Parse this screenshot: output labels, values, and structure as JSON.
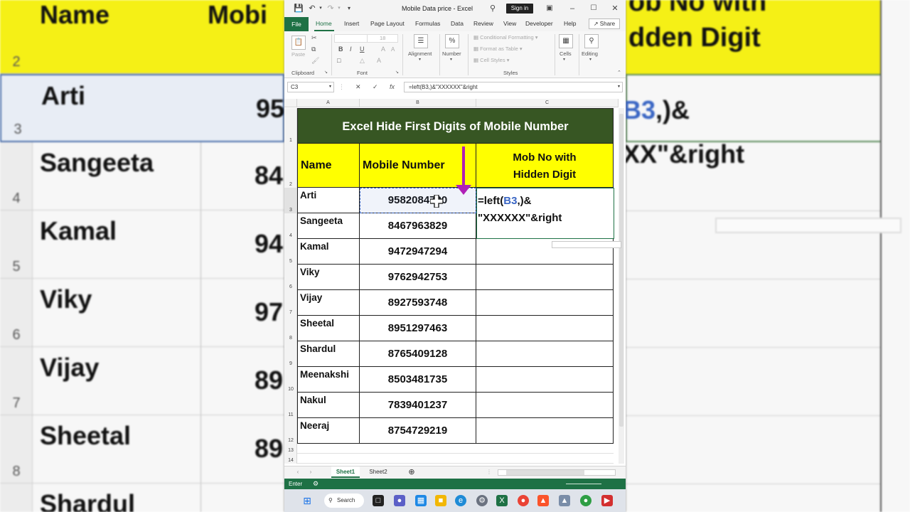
{
  "window": {
    "title": "Mobile Data price  -  Excel",
    "signin": "Sign in"
  },
  "tabs": {
    "file": "File",
    "items": [
      "Home",
      "Insert",
      "Page Layout",
      "Formulas",
      "Data",
      "Review",
      "View",
      "Developer",
      "Help"
    ],
    "share": "Share"
  },
  "ribbon": {
    "clipboard": "Clipboard",
    "paste": "Paste",
    "font": "Font",
    "alignment": "Alignment",
    "number": "Number",
    "conditional_formatting": "Conditional Formatting",
    "format_as_table": "Format as Table",
    "cell_styles": "Cell Styles",
    "styles": "Styles",
    "cells": "Cells",
    "editing": "Editing",
    "font_size": "18"
  },
  "formula_bar": {
    "name_box": "C3",
    "formula": "=left(B3,)&\"XXXXXX\"&right"
  },
  "columns": [
    "A",
    "B",
    "C"
  ],
  "sheet": {
    "title": "Excel Hide First Digits of Mobile Number",
    "header_name": "Name",
    "header_mobile": "Mobile Number",
    "header_hidden_line1": "Mob No with",
    "header_hidden_line2": "Hidden Digit",
    "formula_text_pre": "=left(",
    "formula_text_ref": "B3",
    "formula_text_mid": ",)&",
    "formula_text_line2": "\"XXXXXX\"&right",
    "rows": [
      {
        "row": "3",
        "name": "Arti",
        "mobile": "9582084720"
      },
      {
        "row": "4",
        "name": "Sangeeta",
        "mobile": "8467963829"
      },
      {
        "row": "5",
        "name": "Kamal",
        "mobile": "9472947294"
      },
      {
        "row": "6",
        "name": "Viky",
        "mobile": "9762942753"
      },
      {
        "row": "7",
        "name": "Vijay",
        "mobile": "8927593748"
      },
      {
        "row": "8",
        "name": "Sheetal",
        "mobile": "8951297463"
      },
      {
        "row": "9",
        "name": "Shardul",
        "mobile": "8765409128"
      },
      {
        "row": "10",
        "name": "Meenakshi",
        "mobile": "8503481735"
      },
      {
        "row": "11",
        "name": "Nakul",
        "mobile": "7839401237"
      },
      {
        "row": "12",
        "name": "Neeraj",
        "mobile": "8754729219"
      }
    ],
    "row_numbers_top": [
      "1",
      "2"
    ],
    "row_numbers_bottom": [
      "13",
      "14"
    ]
  },
  "sheet_tabs": [
    "Sheet1",
    "Sheet2"
  ],
  "status": {
    "mode": "Enter"
  },
  "taskbar": {
    "search": "Search"
  },
  "background": {
    "left_rows": [
      {
        "num": "2",
        "name": "Name",
        "mob": "Mobi"
      },
      {
        "num": "3",
        "name": "Arti",
        "mob": "95"
      },
      {
        "num": "4",
        "name": "Sangeeta",
        "mob": "84"
      },
      {
        "num": "5",
        "name": "Kamal",
        "mob": "94"
      },
      {
        "num": "6",
        "name": "Viky",
        "mob": "97"
      },
      {
        "num": "7",
        "name": "Vijay",
        "mob": "89"
      },
      {
        "num": "8",
        "name": "Sheetal",
        "mob": "89"
      },
      {
        "num": "",
        "name": "Shardul",
        "mob": ""
      }
    ],
    "right_lines": [
      "ob No with",
      "dden Digit",
      "B3,)&",
      "XX\"&right"
    ]
  },
  "colors": {
    "excel_green": "#1e7145",
    "title_fill": "#375623",
    "header_fill": "#ffff00",
    "arrow": "#b01fb7",
    "ref": "#3a66c4"
  }
}
